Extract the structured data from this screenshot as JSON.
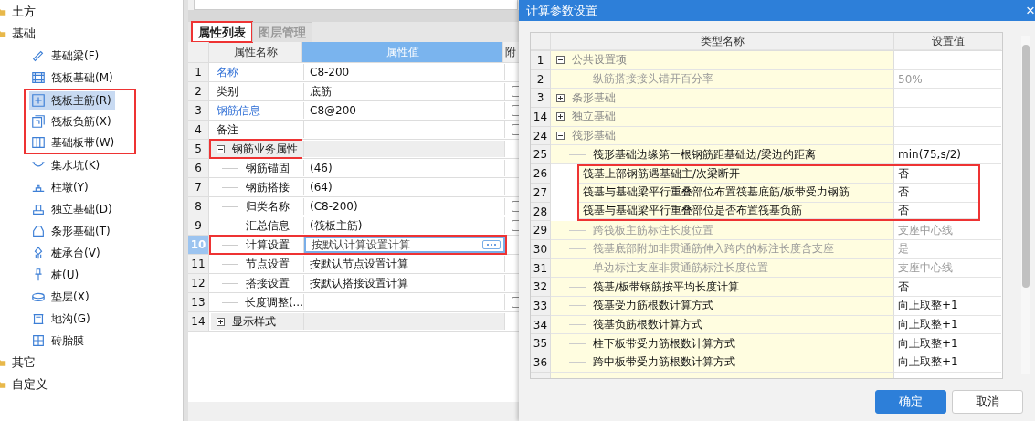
{
  "tree": [
    {
      "label": "土方"
    },
    {
      "label": "基础",
      "children": [
        {
          "label": "基础梁(F)",
          "selected": false,
          "highlighted": false
        },
        {
          "label": "筏板基础(M)",
          "selected": false,
          "highlighted": false
        },
        {
          "label": "筏板主筋(R)",
          "selected": true,
          "highlighted": true
        },
        {
          "label": "筏板负筋(X)",
          "selected": false,
          "highlighted": true
        },
        {
          "label": "基础板带(W)",
          "selected": false,
          "highlighted": true
        },
        {
          "label": "集水坑(K)",
          "selected": false,
          "highlighted": false
        },
        {
          "label": "柱墩(Y)",
          "selected": false,
          "highlighted": false
        },
        {
          "label": "独立基础(D)",
          "selected": false,
          "highlighted": false
        },
        {
          "label": "条形基础(T)",
          "selected": false,
          "highlighted": false
        },
        {
          "label": "桩承台(V)",
          "selected": false,
          "highlighted": false
        },
        {
          "label": "桩(U)",
          "selected": false,
          "highlighted": false
        },
        {
          "label": "垫层(X)",
          "selected": false,
          "highlighted": false
        },
        {
          "label": "地沟(G)",
          "selected": false,
          "highlighted": false
        },
        {
          "label": "砖胎膜",
          "selected": false,
          "highlighted": false
        }
      ]
    },
    {
      "label": "其它"
    },
    {
      "label": "自定义"
    }
  ],
  "property_panel": {
    "tabs": [
      {
        "label": "属性列表",
        "selected": true,
        "highlighted": true
      },
      {
        "label": "图层管理",
        "selected": false,
        "highlighted": false
      }
    ],
    "columns": [
      "属性名称",
      "属性值",
      "附"
    ],
    "rows": [
      {
        "num": "1",
        "kind": "prop",
        "name": "名称",
        "value": "C8-200",
        "linked": true,
        "selected": false,
        "highlighted": false
      },
      {
        "num": "2",
        "kind": "prop",
        "name": "类别",
        "value": "底筋",
        "linked": false,
        "selected": false,
        "highlighted": false,
        "checked": false
      },
      {
        "num": "3",
        "kind": "prop",
        "name": "钢筋信息",
        "value": "C8@200",
        "linked": true,
        "selected": false,
        "highlighted": false,
        "checked": false
      },
      {
        "num": "4",
        "kind": "prop",
        "name": "备注",
        "linked": false,
        "selected": false,
        "highlighted": false,
        "checked": false
      },
      {
        "num": "5",
        "kind": "group",
        "name": "钢筋业务属性",
        "expanded": true,
        "selected": false,
        "highlighted": true
      },
      {
        "num": "6",
        "kind": "child",
        "name": "钢筋锚固",
        "value": "(46)",
        "linked": false,
        "selected": false,
        "highlighted": false
      },
      {
        "num": "7",
        "kind": "child",
        "name": "钢筋搭接",
        "value": "(64)",
        "linked": false,
        "selected": false,
        "highlighted": false
      },
      {
        "num": "8",
        "kind": "child",
        "name": "归类名称",
        "value": "(C8-200)",
        "linked": false,
        "selected": false,
        "highlighted": false,
        "checked": false
      },
      {
        "num": "9",
        "kind": "child",
        "name": "汇总信息",
        "value": "(筏板主筋)",
        "linked": false,
        "selected": false,
        "highlighted": false,
        "checked": false
      },
      {
        "num": "10",
        "kind": "child",
        "name": "计算设置",
        "value": "按默认计算设置计算",
        "linked": false,
        "selected": true,
        "highlighted": true
      },
      {
        "num": "11",
        "kind": "child",
        "name": "节点设置",
        "value": "按默认节点设置计算",
        "linked": false,
        "selected": false,
        "highlighted": false
      },
      {
        "num": "12",
        "kind": "child",
        "name": "搭接设置",
        "value": "按默认搭接设置计算",
        "linked": false,
        "selected": false,
        "highlighted": false
      },
      {
        "num": "13",
        "kind": "child",
        "name": "长度调整(...",
        "linked": false,
        "selected": false,
        "highlighted": false,
        "checked": false
      },
      {
        "num": "14",
        "kind": "group",
        "name": "显示样式",
        "expanded": false,
        "selected": false,
        "highlighted": false
      }
    ]
  },
  "dialog": {
    "title": "计算参数设置",
    "close": "×",
    "columns": [
      "类型名称",
      "设置值"
    ],
    "rows": [
      {
        "num": "1",
        "kind": "group",
        "name": "公共设置项",
        "expanded": true
      },
      {
        "num": "2",
        "kind": "item",
        "name": "纵筋搭接接头错开百分率",
        "value": "50%",
        "disabled": true,
        "highlighted": false
      },
      {
        "num": "3",
        "kind": "group",
        "name": "条形基础",
        "expanded": false
      },
      {
        "num": "14",
        "kind": "group",
        "name": "独立基础",
        "expanded": false
      },
      {
        "num": "24",
        "kind": "group",
        "name": "筏形基础",
        "expanded": true
      },
      {
        "num": "25",
        "kind": "item",
        "name": "筏形基础边缘第一根钢筋距基础边/梁边的距离",
        "value": "min(75,s/2)",
        "disabled": false,
        "highlighted": false
      },
      {
        "num": "26",
        "kind": "item",
        "name": "筏基上部钢筋遇基础主/次梁断开",
        "value": "否",
        "disabled": false,
        "highlighted": true
      },
      {
        "num": "27",
        "kind": "item",
        "name": "筏基与基础梁平行重叠部位布置筏基底筋/板带受力钢筋",
        "value": "否",
        "disabled": false,
        "highlighted": true
      },
      {
        "num": "28",
        "kind": "item",
        "name": "筏基与基础梁平行重叠部位是否布置筏基负筋",
        "value": "否",
        "disabled": false,
        "highlighted": true
      },
      {
        "num": "29",
        "kind": "item",
        "name": "跨筏板主筋标注长度位置",
        "value": "支座中心线",
        "disabled": true,
        "highlighted": false
      },
      {
        "num": "30",
        "kind": "item",
        "name": "筏基底部附加非贯通筋伸入跨内的标注长度含支座",
        "value": "是",
        "disabled": true,
        "highlighted": false
      },
      {
        "num": "31",
        "kind": "item",
        "name": "单边标注支座非贯通筋标注长度位置",
        "value": "支座中心线",
        "disabled": true,
        "highlighted": false
      },
      {
        "num": "32",
        "kind": "item",
        "name": "筏基/板带钢筋按平均长度计算",
        "value": "否",
        "disabled": false,
        "highlighted": false
      },
      {
        "num": "33",
        "kind": "item",
        "name": "筏基受力筋根数计算方式",
        "value": "向上取整+1",
        "disabled": false,
        "highlighted": false
      },
      {
        "num": "34",
        "kind": "item",
        "name": "筏基负筋根数计算方式",
        "value": "向上取整+1",
        "disabled": false,
        "highlighted": false
      },
      {
        "num": "35",
        "kind": "item",
        "name": "柱下板带受力筋根数计算方式",
        "value": "向上取整+1",
        "disabled": false,
        "highlighted": false
      },
      {
        "num": "36",
        "kind": "item",
        "name": "跨中板带受力筋根数计算方式",
        "value": "向上取整+1",
        "disabled": false,
        "highlighted": false
      }
    ],
    "buttons": [
      {
        "label": "确定",
        "kind": "primary"
      },
      {
        "label": "取消",
        "kind": "secondary"
      }
    ]
  }
}
